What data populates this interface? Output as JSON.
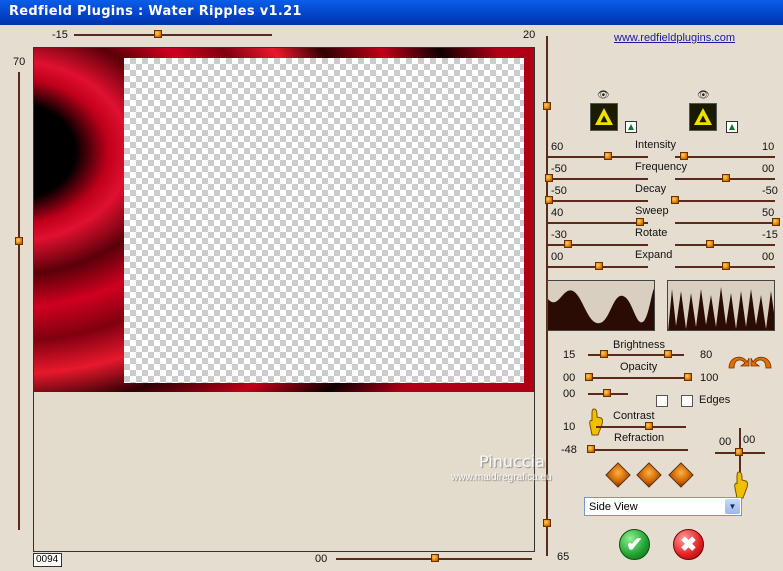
{
  "window": {
    "title": "Redfield Plugins : Water Ripples v1.21"
  },
  "link": {
    "text": "www.redfieldplugins.com"
  },
  "top_slider": {
    "left_value": "-15",
    "right_value": "20"
  },
  "left_slider": {
    "value": "70"
  },
  "bottom_slider": {
    "value": "00",
    "right_value": "65"
  },
  "counter": {
    "value": "0094"
  },
  "params": [
    {
      "label": "Intensity",
      "left": "60",
      "right": "10"
    },
    {
      "label": "Frequency",
      "left": "-50",
      "right": "00"
    },
    {
      "label": "Decay",
      "left": "-50",
      "right": "-50"
    },
    {
      "label": "Sweep",
      "left": "40",
      "right": "50"
    },
    {
      "label": "Rotate",
      "left": "-30",
      "right": "-15"
    },
    {
      "label": "Expand",
      "left": "00",
      "right": "00"
    }
  ],
  "lighting": {
    "brightness": {
      "label": "Brightness",
      "left": "15",
      "right": "80"
    },
    "opacity": {
      "label": "Opacity",
      "left": "00",
      "right": "100"
    },
    "opacity2": {
      "left": "00"
    },
    "edges_label": "Edges",
    "contrast": {
      "label": "Contrast",
      "left": "10"
    },
    "refraction": {
      "label": "Refraction",
      "left": "-48"
    },
    "xy": {
      "left": "00",
      "right": "00"
    }
  },
  "view": {
    "selected": "Side View"
  },
  "watermark": {
    "line1": "Pinuccia",
    "line2": "www.maidiregrafica.eu"
  },
  "icons": {
    "eye": "eye-icon",
    "ok": "check-icon",
    "cancel": "close-icon"
  }
}
